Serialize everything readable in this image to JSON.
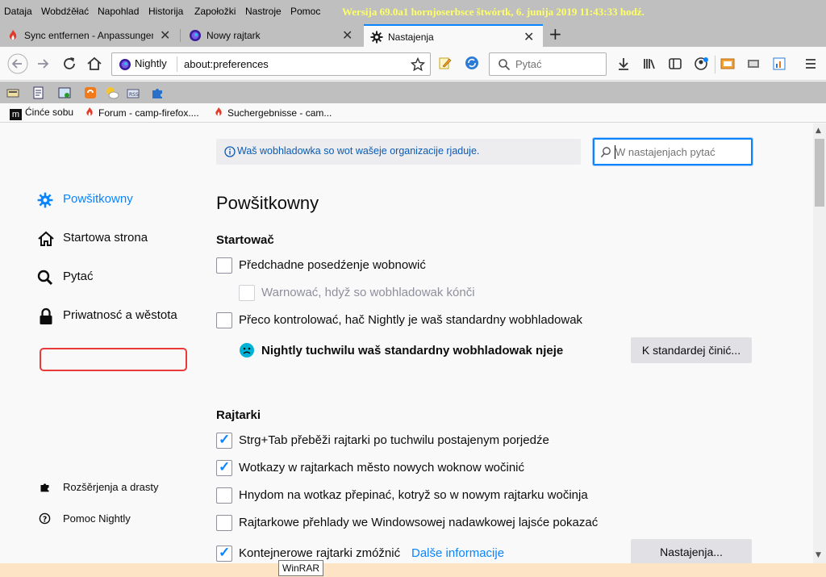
{
  "menubar": {
    "items": [
      "Dataja",
      "Wobdźěłać",
      "Napohlad",
      "Historija",
      "Zapołožki",
      "Nastroje",
      "Pomoc"
    ],
    "title": "Wersija 69.0a1 hornjoserbsce     štwórtk, 6. junija 2019  11:43:33 hodź."
  },
  "tabs": [
    {
      "label": "Sync entfernen - Anpassungen"
    },
    {
      "label": "Nowy rajtark"
    },
    {
      "label": "Nastajenja"
    }
  ],
  "navbar": {
    "identity": "Nightly",
    "url": "about:preferences",
    "search_placeholder": "Pytać"
  },
  "bookmarks": [
    {
      "label": "Ćinće sobu"
    },
    {
      "label": "Forum - camp-firefox...."
    },
    {
      "label": "Suchergebnisse - cam..."
    }
  ],
  "policy_notice": "Waš wobhladowka so wot wašeje organizacije rjaduje.",
  "pref_search_placeholder": "W nastajenjach pytać",
  "categories": [
    {
      "label": "Powšitkowny",
      "icon": "gear-icon",
      "selected": true
    },
    {
      "label": "Startowa strona",
      "icon": "home-icon"
    },
    {
      "label": "Pytać",
      "icon": "search-icon"
    },
    {
      "label": "Priwatnosć a wěstota",
      "icon": "lock-icon"
    }
  ],
  "footer_links": [
    {
      "label": "Rozšěrjenja a drasty",
      "icon": "puzzle-icon"
    },
    {
      "label": "Pomoc Nightly",
      "icon": "help-icon"
    }
  ],
  "pane": {
    "title": "Powšitkowny",
    "startup": {
      "heading": "Startowač",
      "restore_session": "Předchadne posedźenje wobnowić",
      "warn_on_quit": "Warnować, hdyž so wobhladowak kónči",
      "check_default": "Přeco kontrolować, hač Nightly je waš standardny wobhladowak",
      "not_default": "Nightly tuchwilu waš standardny wobhladowak njeje",
      "make_default_button": "K standardej činić..."
    },
    "tabs_section": {
      "heading": "Rajtarki",
      "ctrl_tab": "Strg+Tab přeběži rajtarki po tuchwilu postajenym porjedźe",
      "links_in_tabs": "Wotkazy w rajtarkach město nowych woknow wočinić",
      "switch_immediately": "Hnydom na wotkaz přepinać, kotryž so w nowym rajtarku wočinja",
      "taskbar_previews": "Rajtarkowe přehlady we Windowsowej nadawkowej lajsće pokazać",
      "containers": "Kontejnerowe rajtarki zmóžnić",
      "learn_more": "Dalše informacije",
      "settings_button": "Nastajenja..."
    },
    "checked": {
      "restore_session": false,
      "warn_on_quit": false,
      "check_default": false,
      "ctrl_tab": true,
      "links_in_tabs": true,
      "switch_immediately": false,
      "taskbar_previews": false,
      "containers": true
    }
  },
  "tooltip": "WinRAR",
  "colors": {
    "accent": "#0a84ff",
    "highlight_box": "#e83a3a",
    "title_text": "#ffff66"
  }
}
